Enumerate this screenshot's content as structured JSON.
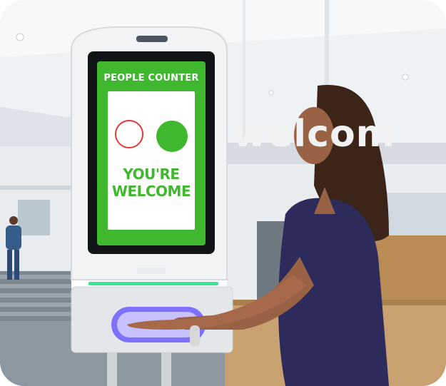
{
  "kiosk": {
    "screen_title": "PEOPLE COUNTER",
    "message_line1": "YOU'RE",
    "message_line2": "WELCOME",
    "indicator_colors": {
      "empty": "#e53935",
      "filled": "#3fb82f"
    },
    "accent_light": "#38e39a",
    "sanitizer_glow": "#6f5cff"
  },
  "background": {
    "sign_text": "welcom"
  }
}
